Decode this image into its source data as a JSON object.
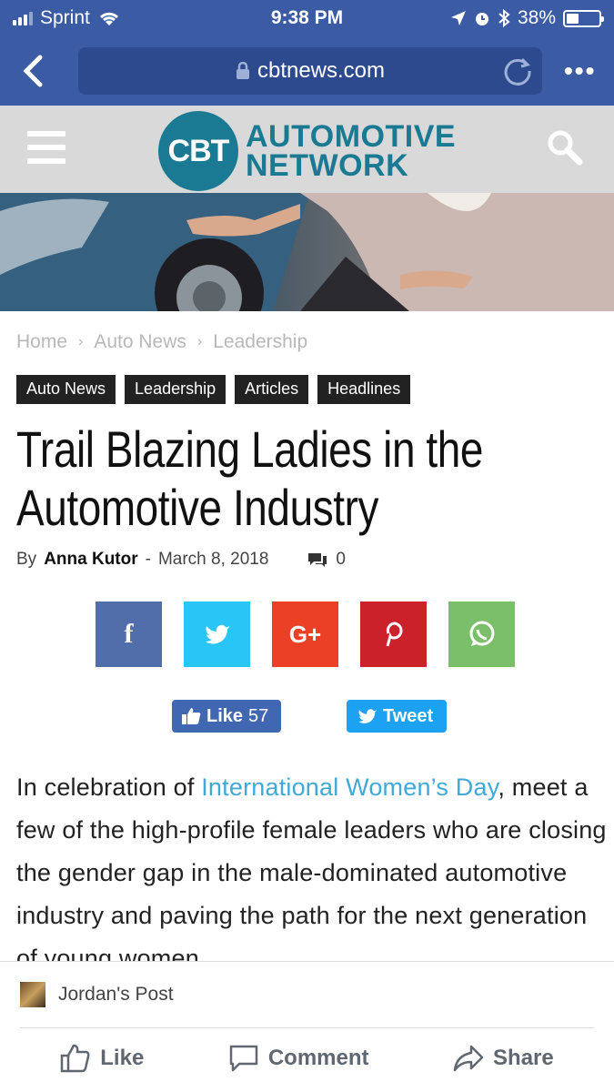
{
  "status_bar": {
    "carrier": "Sprint",
    "time": "9:38 PM",
    "battery": "38%",
    "battery_level": 0.38,
    "icons": [
      "signal-icon",
      "wifi-icon",
      "location-icon",
      "alarm-icon",
      "bluetooth-icon",
      "battery-icon"
    ]
  },
  "browser": {
    "url": "cbtnews.com",
    "icons": [
      "back-icon",
      "lock-icon",
      "reload-icon",
      "more-icon"
    ]
  },
  "site_header": {
    "logo_circle": "CBT",
    "logo_line1": "AUTOMOTIVE",
    "logo_line2": "NETWORK",
    "brand_color": "#1b7a93"
  },
  "breadcrumb": {
    "items": [
      "Home",
      "Auto News",
      "Leadership"
    ],
    "separator": "›"
  },
  "tags": [
    "Auto News",
    "Leadership",
    "Articles",
    "Headlines"
  ],
  "article": {
    "title_line1": "Trail Blazing Ladies in the",
    "title_line2": "Automotive Industry",
    "by": "By",
    "author": "Anna Kutor",
    "dash": "-",
    "date": "March 8, 2018",
    "comment_count": "0",
    "body_prefix": "In celebration of ",
    "body_link": "International Women’s Day",
    "body_rest": ", meet a few of the high-profile female leaders who are closing the gender gap in the male-dominated automotive industry and paving the path for the next generation of young women"
  },
  "share_buttons": [
    {
      "name": "facebook",
      "glyph": "f",
      "color": "#516eab"
    },
    {
      "name": "twitter",
      "glyph": "",
      "color": "#29c5f6"
    },
    {
      "name": "google-plus",
      "glyph": "G+",
      "color": "#eb4026"
    },
    {
      "name": "pinterest",
      "glyph": "P",
      "color": "#ca212a"
    },
    {
      "name": "whatsapp",
      "glyph": "",
      "color": "#7bbf6a"
    }
  ],
  "social": {
    "like_label": "Like",
    "like_count": "57",
    "tweet_label": "Tweet"
  },
  "fb_bar": {
    "post_label": "Jordan's Post",
    "like": "Like",
    "comment": "Comment",
    "share": "Share"
  }
}
